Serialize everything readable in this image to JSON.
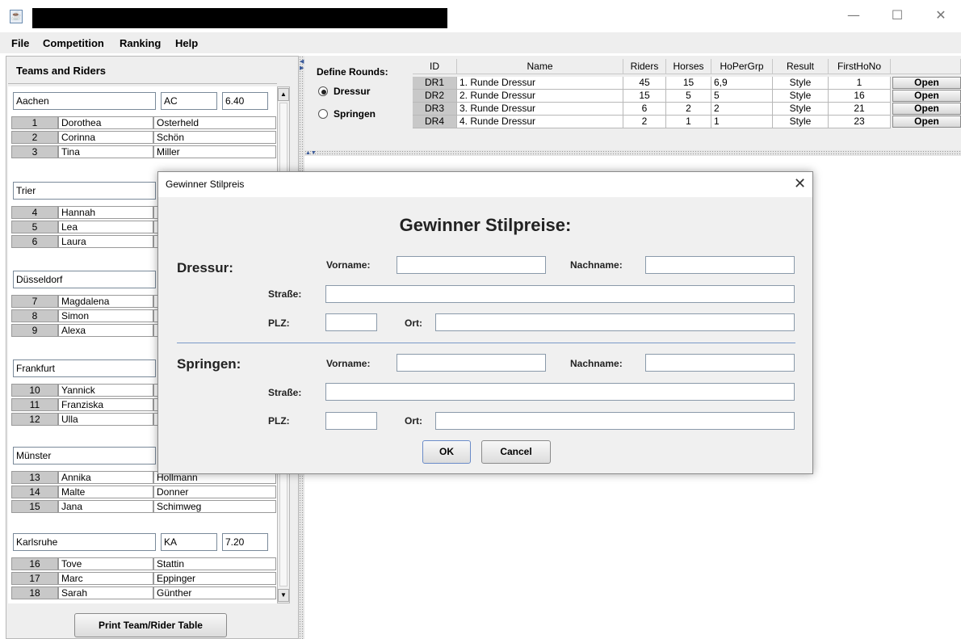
{
  "window": {
    "icon": "java-cup-icon",
    "controls": {
      "minimize": "—",
      "maximize": "☐",
      "close": "✕"
    }
  },
  "menu": [
    "File",
    "Competition",
    "Ranking",
    "Help"
  ],
  "left": {
    "title": "Teams and Riders",
    "teams": [
      {
        "name": "Aachen",
        "code": "AC",
        "score": "6.40",
        "riders": [
          {
            "no": "1",
            "first": "Dorothea",
            "last": "Osterheld"
          },
          {
            "no": "2",
            "first": "Corinna",
            "last": "Schön"
          },
          {
            "no": "3",
            "first": "Tina",
            "last": "Miller"
          }
        ]
      },
      {
        "name": "Trier",
        "code": "",
        "score": "",
        "riders": [
          {
            "no": "4",
            "first": "Hannah",
            "last": ""
          },
          {
            "no": "5",
            "first": "Lea",
            "last": ""
          },
          {
            "no": "6",
            "first": "Laura",
            "last": ""
          }
        ]
      },
      {
        "name": "Düsseldorf",
        "code": "",
        "score": "",
        "riders": [
          {
            "no": "7",
            "first": "Magdalena",
            "last": ""
          },
          {
            "no": "8",
            "first": "Simon",
            "last": ""
          },
          {
            "no": "9",
            "first": "Alexa",
            "last": ""
          }
        ]
      },
      {
        "name": "Frankfurt",
        "code": "",
        "score": "",
        "riders": [
          {
            "no": "10",
            "first": "Yannick",
            "last": ""
          },
          {
            "no": "11",
            "first": "Franziska",
            "last": ""
          },
          {
            "no": "12",
            "first": "Ulla",
            "last": ""
          }
        ]
      },
      {
        "name": "Münster",
        "code": "",
        "score": "",
        "riders": [
          {
            "no": "13",
            "first": "Annika",
            "last": "Hollmann"
          },
          {
            "no": "14",
            "first": "Malte",
            "last": "Donner"
          },
          {
            "no": "15",
            "first": "Jana",
            "last": "Schimweg"
          }
        ]
      },
      {
        "name": "Karlsruhe",
        "code": "KA",
        "score": "7.20",
        "riders": [
          {
            "no": "16",
            "first": "Tove",
            "last": "Stattin"
          },
          {
            "no": "17",
            "first": "Marc",
            "last": "Eppinger"
          },
          {
            "no": "18",
            "first": "Sarah",
            "last": "Günther"
          }
        ]
      }
    ],
    "print_button": "Print Team/Rider Table"
  },
  "rounds": {
    "define_label": "Define Rounds:",
    "options": [
      {
        "label": "Dressur",
        "selected": true
      },
      {
        "label": "Springen",
        "selected": false
      }
    ],
    "columns": [
      "ID",
      "Name",
      "Riders",
      "Horses",
      "HoPerGrp",
      "Result",
      "FirstHoNo",
      ""
    ],
    "rows": [
      {
        "id": "DR1",
        "name": "1. Runde Dressur",
        "riders": "45",
        "horses": "15",
        "hopergrp": "6,9",
        "result": "Style",
        "firsthono": "1",
        "action": "Open"
      },
      {
        "id": "DR2",
        "name": "2. Runde Dressur",
        "riders": "15",
        "horses": "5",
        "hopergrp": "5",
        "result": "Style",
        "firsthono": "16",
        "action": "Open"
      },
      {
        "id": "DR3",
        "name": "3. Runde Dressur",
        "riders": "6",
        "horses": "2",
        "hopergrp": "2",
        "result": "Style",
        "firsthono": "21",
        "action": "Open"
      },
      {
        "id": "DR4",
        "name": "4. Runde Dressur",
        "riders": "2",
        "horses": "1",
        "hopergrp": "1",
        "result": "Style",
        "firsthono": "23",
        "action": "Open"
      }
    ]
  },
  "dialog": {
    "title": "Gewinner Stilpreis",
    "close": "✕",
    "heading": "Gewinner Stilpreise:",
    "sections": [
      {
        "title": "Dressur:",
        "vorname_label": "Vorname:",
        "vorname": "",
        "nachname_label": "Nachname:",
        "nachname": "",
        "strasse_label": "Straße:",
        "strasse": "",
        "plz_label": "PLZ:",
        "plz": "",
        "ort_label": "Ort:",
        "ort": ""
      },
      {
        "title": "Springen:",
        "vorname_label": "Vorname:",
        "vorname": "",
        "nachname_label": "Nachname:",
        "nachname": "",
        "strasse_label": "Straße:",
        "strasse": "",
        "plz_label": "PLZ:",
        "plz": "",
        "ort_label": "Ort:",
        "ort": ""
      }
    ],
    "ok": "OK",
    "cancel": "Cancel"
  }
}
